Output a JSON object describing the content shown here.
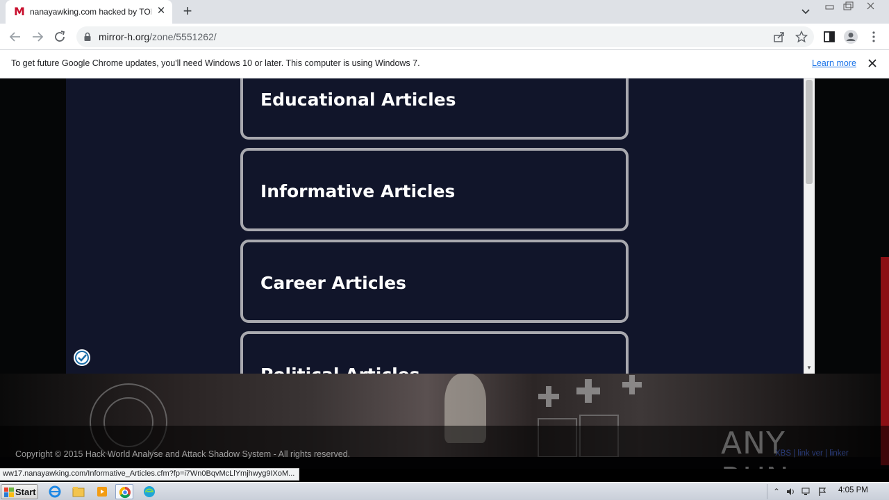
{
  "browser": {
    "tab": {
      "favicon_letter": "M",
      "title": "nanayawking.com hacked by TOMODACHI"
    },
    "new_tab_symbol": "+",
    "close_symbol": "✕",
    "address": {
      "host": "mirror-h.org",
      "path": "/zone/5551262/"
    }
  },
  "infobar": {
    "message": "To get future Google Chrome updates, you'll need Windows 10 or later. This computer is using Windows 7.",
    "learn_more": "Learn more"
  },
  "page": {
    "cards": [
      {
        "label": "Educational Articles"
      },
      {
        "label": "Informative Articles"
      },
      {
        "label": "Career Articles"
      },
      {
        "label": "Political Articles"
      }
    ],
    "copyright": "Copyright © 2015 Hack World Analyse and Attack Shadow System - All rights reserved.",
    "footer_links": "XBS | link ver | linker",
    "watermark": "ANY RUN"
  },
  "status_url": "ww17.nanayawking.com/Informative_Articles.cfm?fp=i7Wn0BqvMcLlYmjhwyg9IXoM...",
  "taskbar": {
    "start_label": "Start",
    "clock": "4:05 PM"
  }
}
